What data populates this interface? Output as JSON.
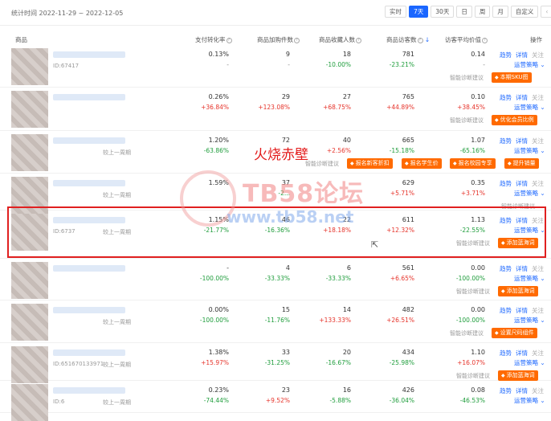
{
  "topbar": {
    "stat_time": "统计时间 2022-11-29 ~ 2022-12-05",
    "ranges": [
      "实时",
      "7天",
      "30天",
      "日",
      "周",
      "月",
      "自定义"
    ],
    "active_range": "7天",
    "prev": "‹",
    "next": "›"
  },
  "columns": [
    "商品",
    "支付转化率",
    "商品加购件数",
    "商品收藏人数",
    "商品访客数",
    "访客平均价值",
    "操作"
  ],
  "sort_arrow": "↓",
  "ops": {
    "trend": "趋势",
    "detail": "详情",
    "follow": "关注",
    "strategy": "运营策略",
    "diag": "智能诊断建议"
  },
  "rows": [
    {
      "id": "ID:67417",
      "cmp": "",
      "conv": "0.13%",
      "conv_pct": "-",
      "add": "9",
      "add_pct": "-",
      "fav": "18",
      "fav_pct": "-10.00%",
      "visit": "781",
      "visit_pct": "-23.21%",
      "avg": "0.14",
      "avg_pct": "-",
      "tags": [
        "本期SKU图"
      ]
    },
    {
      "id": "",
      "cmp": "",
      "conv": "0.26%",
      "conv_pct": "+36.84%",
      "add": "29",
      "add_pct": "+123.08%",
      "fav": "27",
      "fav_pct": "+68.75%",
      "visit": "765",
      "visit_pct": "+44.89%",
      "avg": "0.10",
      "avg_pct": "+38.45%",
      "tags": [
        "优化会员比例"
      ]
    },
    {
      "id": "",
      "cmp": "较上一周期",
      "conv": "1.20%",
      "conv_pct": "-63.86%",
      "add": "72",
      "add_pct": "",
      "fav": "40",
      "fav_pct": "+2.56%",
      "visit": "665",
      "visit_pct": "-15.18%",
      "avg": "1.07",
      "avg_pct": "-65.16%",
      "tags": [
        "报名新客折扣",
        "报名学生价",
        "报名校园专享",
        "提升销量"
      ]
    },
    {
      "id": "",
      "cmp": "较上一周期",
      "conv": "1.59%",
      "conv_pct": "",
      "add": "37",
      "add_pct": "-2...",
      "fav": "",
      "fav_pct": "",
      "visit": "629",
      "visit_pct": "+5.71%",
      "avg": "0.35",
      "avg_pct": "+3.71%",
      "tags": []
    },
    {
      "id": "ID:6737",
      "cmp": "较上一周期",
      "conv": "1.15%",
      "conv_pct": "-21.77%",
      "add": "46",
      "add_pct": "-16.36%",
      "fav": "22",
      "fav_pct": "+18.18%",
      "visit": "611",
      "visit_pct": "+12.32%",
      "avg": "1.13",
      "avg_pct": "-22.55%",
      "tags": [
        "添加蓝海词"
      ]
    },
    {
      "id": "",
      "cmp": "",
      "conv": "-",
      "conv_pct": "-100.00%",
      "add": "4",
      "add_pct": "-33.33%",
      "fav": "6",
      "fav_pct": "-33.33%",
      "visit": "561",
      "visit_pct": "+6.65%",
      "avg": "0.00",
      "avg_pct": "-100.00%",
      "tags": [
        "添加蓝海词"
      ]
    },
    {
      "id": "",
      "cmp": "较上一周期",
      "conv": "0.00%",
      "conv_pct": "-100.00%",
      "add": "15",
      "add_pct": "-11.76%",
      "fav": "14",
      "fav_pct": "+133.33%",
      "visit": "482",
      "visit_pct": "+26.51%",
      "avg": "0.00",
      "avg_pct": "-100.00%",
      "tags": [
        "设置尺码组件"
      ]
    },
    {
      "id": "ID:651670133971",
      "cmp": "较上一周期",
      "conv": "1.38%",
      "conv_pct": "+15.97%",
      "add": "33",
      "add_pct": "-31.25%",
      "fav": "20",
      "fav_pct": "-16.67%",
      "visit": "434",
      "visit_pct": "-25.98%",
      "avg": "1.10",
      "avg_pct": "+16.07%",
      "tags": [
        "添加蓝海词"
      ]
    },
    {
      "id": "ID:6",
      "cmp": "较上一周期",
      "conv": "0.23%",
      "conv_pct": "-74.44%",
      "add": "23",
      "add_pct": "+9.52%",
      "fav": "16",
      "fav_pct": "-5.88%",
      "visit": "426",
      "visit_pct": "-36.04%",
      "avg": "0.08",
      "avg_pct": "-46.53%",
      "tags": []
    }
  ],
  "watermark": {
    "red": "火烧赤壁",
    "big": "TB58论坛",
    "url": "www.tb58.net"
  },
  "cursor": "⇱"
}
